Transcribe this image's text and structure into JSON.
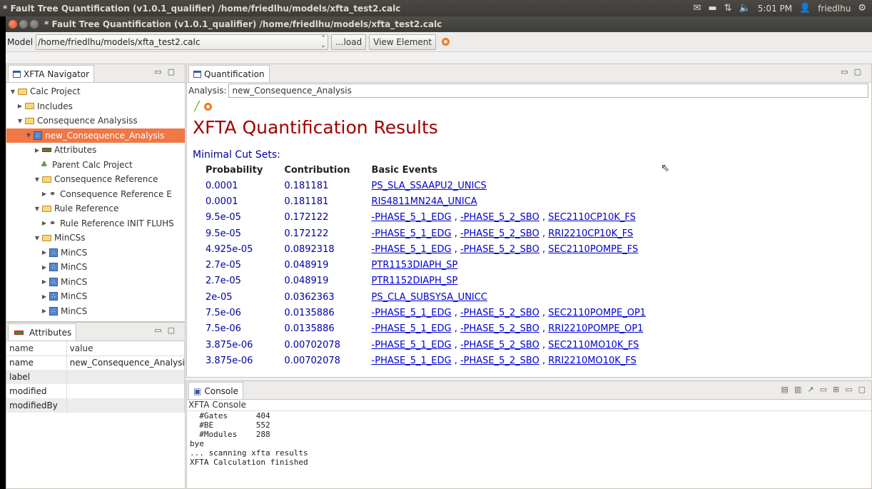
{
  "system_bar": {
    "title": "* Fault Tree Quantification (v1.0.1_qualifier)  /home/friedlhu/models/xfta_test2.calc",
    "time": "5:01 PM",
    "user": "friedlhu"
  },
  "window": {
    "title": "* Fault Tree Quantification (v1.0.1_qualifier)  /home/friedlhu/models/xfta_test2.calc"
  },
  "model_bar": {
    "label": "Model",
    "path": "/home/friedlhu/models/xfta_test2.calc",
    "load_label": "...load",
    "view_element_label": "View Element"
  },
  "navigator": {
    "tab_label": "XFTA Navigator",
    "tree": [
      {
        "label": "Calc Project",
        "icon": "folder-icon",
        "arrow": "down",
        "indent": 0
      },
      {
        "label": "Includes",
        "icon": "folder-icon",
        "arrow": "right",
        "indent": 1
      },
      {
        "label": "Consequence Analysiss",
        "icon": "folder-icon",
        "arrow": "down",
        "indent": 1
      },
      {
        "label": "new_Consequence_Analysis",
        "icon": "analysis-icon",
        "arrow": "down",
        "indent": 2,
        "selected": true
      },
      {
        "label": "Attributes",
        "icon": "attributes-icon",
        "arrow": "right",
        "indent": 3
      },
      {
        "label": "Parent Calc Project",
        "icon": "project-icon",
        "arrow": "",
        "indent": 3
      },
      {
        "label": "Consequence Reference",
        "icon": "folder-icon",
        "arrow": "down",
        "indent": 3
      },
      {
        "label": "Consequence Reference E",
        "icon": "link-icon",
        "arrow": "right",
        "indent": 4
      },
      {
        "label": "Rule Reference",
        "icon": "folder-icon",
        "arrow": "down",
        "indent": 3
      },
      {
        "label": "Rule Reference INIT FLUHS",
        "icon": "link-icon",
        "arrow": "right",
        "indent": 4
      },
      {
        "label": "MinCSs",
        "icon": "folder-icon",
        "arrow": "down",
        "indent": 3
      },
      {
        "label": "MinCS",
        "icon": "mincs-icon",
        "arrow": "right",
        "indent": 4
      },
      {
        "label": "MinCS",
        "icon": "mincs-icon",
        "arrow": "right",
        "indent": 4
      },
      {
        "label": "MinCS",
        "icon": "mincs-icon",
        "arrow": "right",
        "indent": 4
      },
      {
        "label": "MinCS",
        "icon": "mincs-icon",
        "arrow": "right",
        "indent": 4
      },
      {
        "label": "MinCS",
        "icon": "mincs-icon",
        "arrow": "right",
        "indent": 4
      }
    ]
  },
  "attributes": {
    "tab_label": "Attributes",
    "col_name": "name",
    "col_value": "value",
    "rows": [
      {
        "name": "name",
        "value": "new_Consequence_Analysis"
      },
      {
        "name": "label",
        "value": ""
      },
      {
        "name": "modified",
        "value": ""
      },
      {
        "name": "modifiedBy",
        "value": ""
      }
    ]
  },
  "quantification": {
    "tab_label": "Quantification",
    "analysis_label": "Analysis:",
    "analysis_value": "new_Consequence_Analysis",
    "heading": "XFTA Quantification Results",
    "subheading": "Minimal Cut Sets:",
    "columns": [
      "Probability",
      "Contribution",
      "Basic Events"
    ],
    "rows": [
      {
        "p": "0.0001",
        "c": "0.181181",
        "events": [
          "PS_SLA_SSAAPU2_UNICS"
        ]
      },
      {
        "p": "0.0001",
        "c": "0.181181",
        "events": [
          "RIS4811MN24A_UNICA"
        ]
      },
      {
        "p": "9.5e-05",
        "c": "0.172122",
        "events": [
          "-PHASE_5_1_EDG",
          "-PHASE_5_2_SBO",
          "SEC2110CP10K_FS"
        ]
      },
      {
        "p": "9.5e-05",
        "c": "0.172122",
        "events": [
          "-PHASE_5_1_EDG",
          "-PHASE_5_2_SBO",
          "RRI2210CP10K_FS"
        ]
      },
      {
        "p": "4.925e-05",
        "c": "0.0892318",
        "events": [
          "-PHASE_5_1_EDG",
          "-PHASE_5_2_SBO",
          "SEC2110POMPE_FS"
        ]
      },
      {
        "p": "2.7e-05",
        "c": "0.048919",
        "events": [
          "PTR1153DIAPH_SP"
        ]
      },
      {
        "p": "2.7e-05",
        "c": "0.048919",
        "events": [
          "PTR1152DIAPH_SP"
        ]
      },
      {
        "p": "2e-05",
        "c": "0.0362363",
        "events": [
          "PS_CLA_SUBSYSA_UNICC"
        ]
      },
      {
        "p": "7.5e-06",
        "c": "0.0135886",
        "events": [
          "-PHASE_5_1_EDG",
          "-PHASE_5_2_SBO",
          "SEC2110POMPE_OP1"
        ]
      },
      {
        "p": "7.5e-06",
        "c": "0.0135886",
        "events": [
          "-PHASE_5_1_EDG",
          "-PHASE_5_2_SBO",
          "RRI2210POMPE_OP1"
        ]
      },
      {
        "p": "3.875e-06",
        "c": "0.00702078",
        "events": [
          "-PHASE_5_1_EDG",
          "-PHASE_5_2_SBO",
          "SEC2110MO10K_FS"
        ]
      },
      {
        "p": "3.875e-06",
        "c": "0.00702078",
        "events": [
          "-PHASE_5_1_EDG",
          "-PHASE_5_2_SBO",
          "RRI2210MO10K_FS"
        ]
      }
    ]
  },
  "console": {
    "tab_label": "Console",
    "name": "XFTA Console",
    "lines": [
      "  #Gates      404",
      "  #BE         552",
      "  #Modules    288",
      "bye",
      "... scanning xfta results",
      "XFTA Calculation finished"
    ]
  },
  "colors": {
    "selection": "#f07746",
    "heading": "#a00000",
    "link": "#0000d0"
  }
}
